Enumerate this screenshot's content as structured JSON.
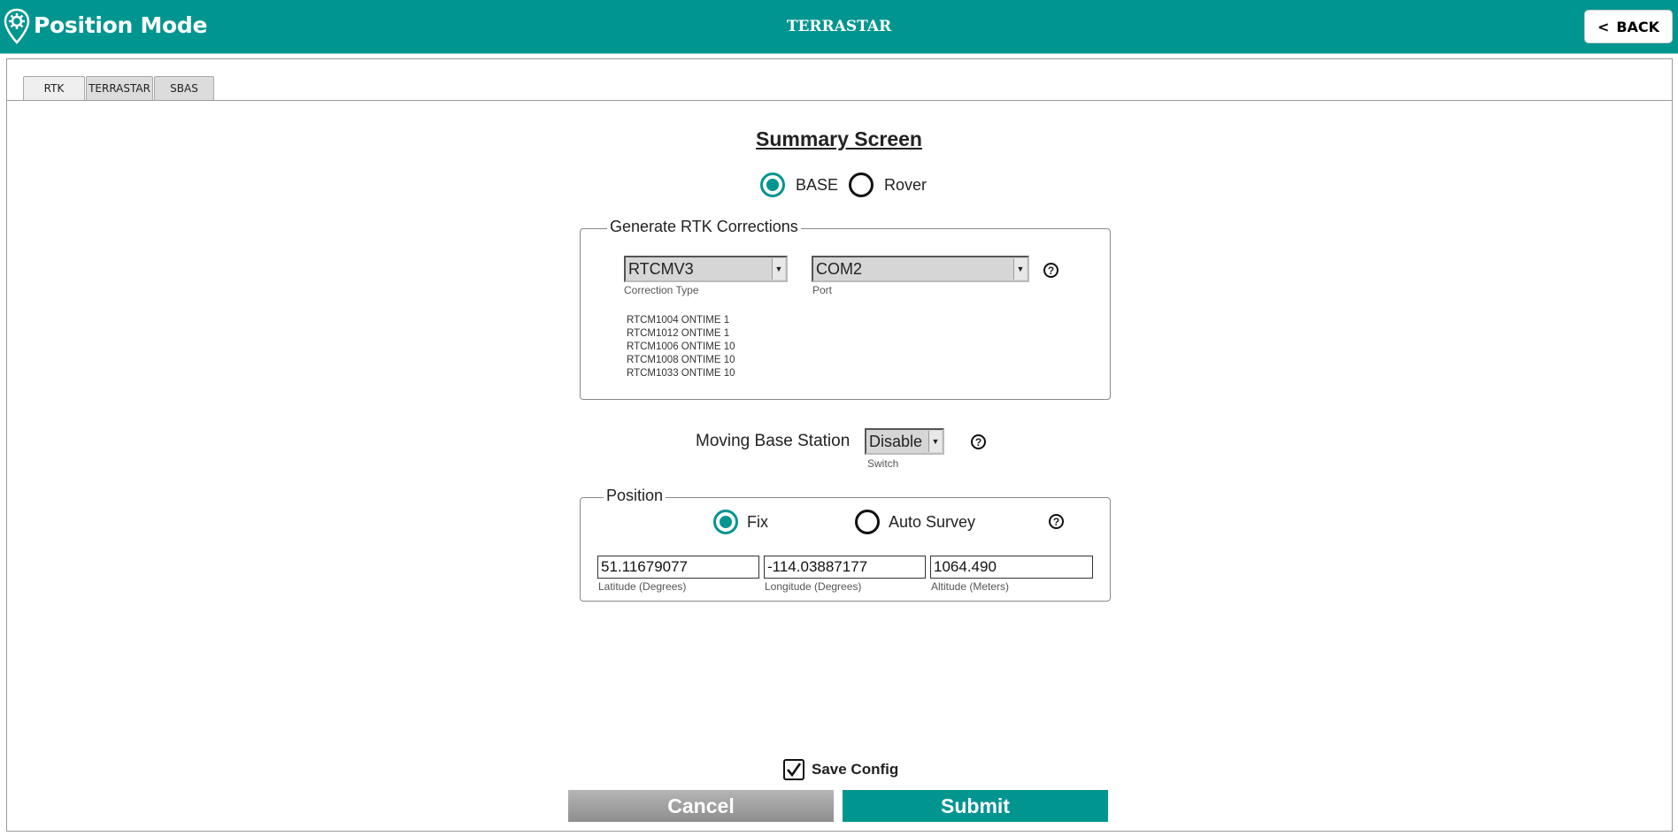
{
  "header": {
    "app_title": "Position Mode",
    "center_title": "TERRASTAR",
    "back_label": "BACK",
    "color": "#019590"
  },
  "tabs": [
    {
      "label": "RTK",
      "active": true
    },
    {
      "label": "TERRASTAR",
      "active": false
    },
    {
      "label": "SBAS",
      "active": false
    }
  ],
  "summary": {
    "title": "Summary Screen",
    "mode": {
      "options": [
        {
          "label": "BASE",
          "selected": true
        },
        {
          "label": "Rover",
          "selected": false
        }
      ]
    }
  },
  "corrections": {
    "legend": "Generate RTK Corrections",
    "correction_type": {
      "value": "RTCMV3",
      "caption": "Correction Type"
    },
    "port": {
      "value": "COM2",
      "caption": "Port"
    },
    "help": "?",
    "messages": [
      "RTCM1004 ONTIME 1",
      "RTCM1012 ONTIME 1",
      "RTCM1006 ONTIME 10",
      "RTCM1008 ONTIME 10",
      "RTCM1033 ONTIME 10"
    ]
  },
  "moving_base": {
    "label": "Moving Base Station",
    "value": "Disable",
    "caption": "Switch",
    "help": "?"
  },
  "position": {
    "legend": "Position",
    "options": [
      {
        "label": "Fix",
        "selected": true
      },
      {
        "label": "Auto Survey",
        "selected": false
      }
    ],
    "help": "?",
    "latitude": {
      "value": "51.11679077",
      "caption": "Latitude (Degrees)"
    },
    "longitude": {
      "value": "-114.03887177",
      "caption": "Longitude (Degrees)"
    },
    "altitude": {
      "value": "1064.490",
      "caption": "Altitude (Meters)"
    }
  },
  "footer": {
    "save_config_label": "Save Config",
    "save_config_checked": true,
    "cancel_label": "Cancel",
    "submit_label": "Submit"
  }
}
